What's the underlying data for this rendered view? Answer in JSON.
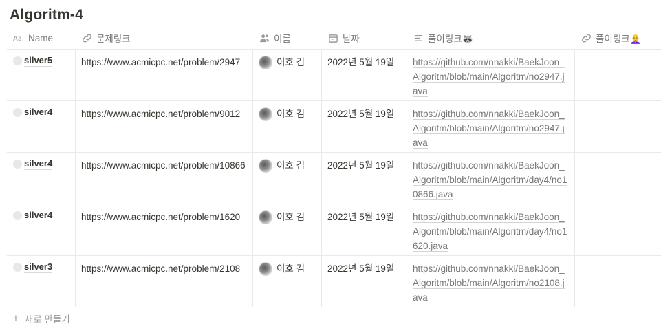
{
  "title": "Algoritm-4",
  "columns": [
    {
      "label": "Name",
      "icon": "title-aa-icon"
    },
    {
      "label": "문제링크",
      "icon": "link-icon"
    },
    {
      "label": "이름",
      "icon": "person-icon"
    },
    {
      "label": "날짜",
      "icon": "calendar-icon"
    },
    {
      "label": "풀이링크🦝",
      "icon": "text-icon"
    },
    {
      "label": "풀이링크👩‍🦲",
      "icon": "link-icon"
    }
  ],
  "rows": [
    {
      "name": "silver5",
      "problem_link": "https://www.acmicpc.net/problem/2947",
      "person": "이호 김",
      "date": "2022년 5월 19일",
      "solution_link": "https://github.com/nnakki/BaekJoon_Algoritm/blob/main/Algoritm/no2947.java",
      "solution_link2": ""
    },
    {
      "name": "silver4",
      "problem_link": "https://www.acmicpc.net/problem/9012",
      "person": "이호 김",
      "date": "2022년 5월 19일",
      "solution_link": "https://github.com/nnakki/BaekJoon_Algoritm/blob/main/Algoritm/no2947.java",
      "solution_link2": ""
    },
    {
      "name": "silver4",
      "problem_link": "https://www.acmicpc.net/problem/10866",
      "person": "이호 김",
      "date": "2022년 5월 19일",
      "solution_link": "https://github.com/nnakki/BaekJoon_Algoritm/blob/main/Algoritm/day4/no10866.java",
      "solution_link2": ""
    },
    {
      "name": "silver4",
      "problem_link": "https://www.acmicpc.net/problem/1620",
      "person": "이호 김",
      "date": "2022년 5월 19일",
      "solution_link": "https://github.com/nnakki/BaekJoon_Algoritm/blob/main/Algoritm/day4/no1620.java",
      "solution_link2": ""
    },
    {
      "name": "silver3",
      "problem_link": "https://www.acmicpc.net/problem/2108",
      "person": "이호 김",
      "date": "2022년 5월 19일",
      "solution_link": "https://github.com/nnakki/BaekJoon_Algoritm/blob/main/Algoritm/no2108.java",
      "solution_link2": ""
    }
  ],
  "new_row_label": "새로 만들기"
}
